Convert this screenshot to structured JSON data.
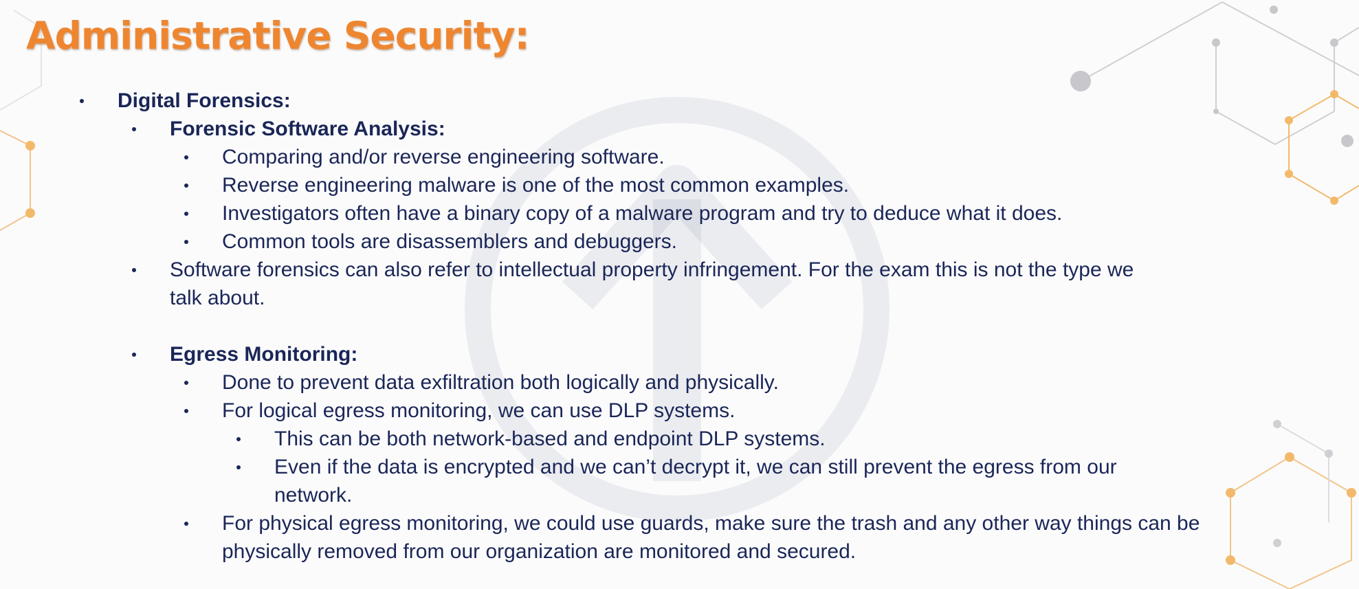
{
  "slide": {
    "title": "Administrative Security:",
    "colors": {
      "title": "#ee8631",
      "text": "#1a2657",
      "accent": "#f0a842"
    },
    "bullets": {
      "digital_forensics": "Digital Forensics:",
      "forensic_software_analysis": "Forensic Software Analysis:",
      "fsa_1": "Comparing and/or reverse engineering software.",
      "fsa_2": "Reverse engineering malware is one of the most common examples.",
      "fsa_3": "Investigators often have a binary copy of a malware program and try to deduce what it does.",
      "fsa_4": "Common tools are disassemblers and debuggers.",
      "software_forensics_line1": "Software forensics can also refer to intellectual property infringement. For the exam this is not the type we",
      "software_forensics_line2": "talk about.",
      "egress_monitoring": "Egress Monitoring:",
      "egress_1": "Done to prevent data exfiltration both logically and physically.",
      "egress_2": "For logical egress monitoring, we can use DLP systems.",
      "egress_2a": "This can be both network-based and endpoint DLP systems.",
      "egress_2b_line1": "Even if the data is encrypted and we can’t decrypt it, we can still prevent the egress from our",
      "egress_2b_line2": "network.",
      "egress_3_line1": "For physical egress monitoring, we could use guards, make sure the trash and any other way things can be",
      "egress_3_line2": "physically removed from our organization are monitored and secured."
    }
  }
}
